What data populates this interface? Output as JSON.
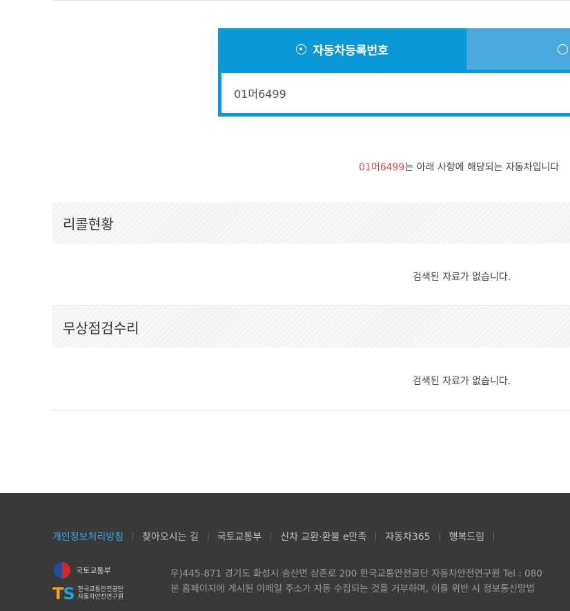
{
  "search": {
    "tabs": [
      {
        "label": "자동차등록번호",
        "selected": true
      },
      {
        "label": "",
        "selected": false
      }
    ],
    "value": "01머6499"
  },
  "result": {
    "plate": "01머6499",
    "sentence": "는 아래 사항에 해당되는 자동차입니다"
  },
  "sections": [
    {
      "title": "리콜현황",
      "empty_message": "검색된 자료가 없습니다."
    },
    {
      "title": "무상점검수리",
      "empty_message": "검색된 자료가 없습니다."
    }
  ],
  "footer": {
    "links": [
      "개인정보처리방침",
      "찾아오시는 길",
      "국토교통부",
      "신차 교환·환불 e만족",
      "자동차365",
      "행복드림"
    ],
    "ministry_logo_text": "국토교통부",
    "ts_logo_lines": [
      "한국교통안전공단",
      "자동차안전연구원"
    ],
    "address_lines": [
      "우)445-871 경기도 화성시 송산면 삼존로 200 한국교통안전공단 자동차안전연구원 Tel : 080",
      "본 홈페이지에 게시된 이메일 주소가 자동 수집되는 것을 거부하며, 이를 위반 시 정보통신망법"
    ]
  },
  "colors": {
    "brand_blue": "#0b98d8",
    "tab_inactive": "#4aa8dc",
    "plate_red": "#e0464f",
    "footer_bg": "#393939",
    "footer_primary_link": "#3aa6e0"
  }
}
